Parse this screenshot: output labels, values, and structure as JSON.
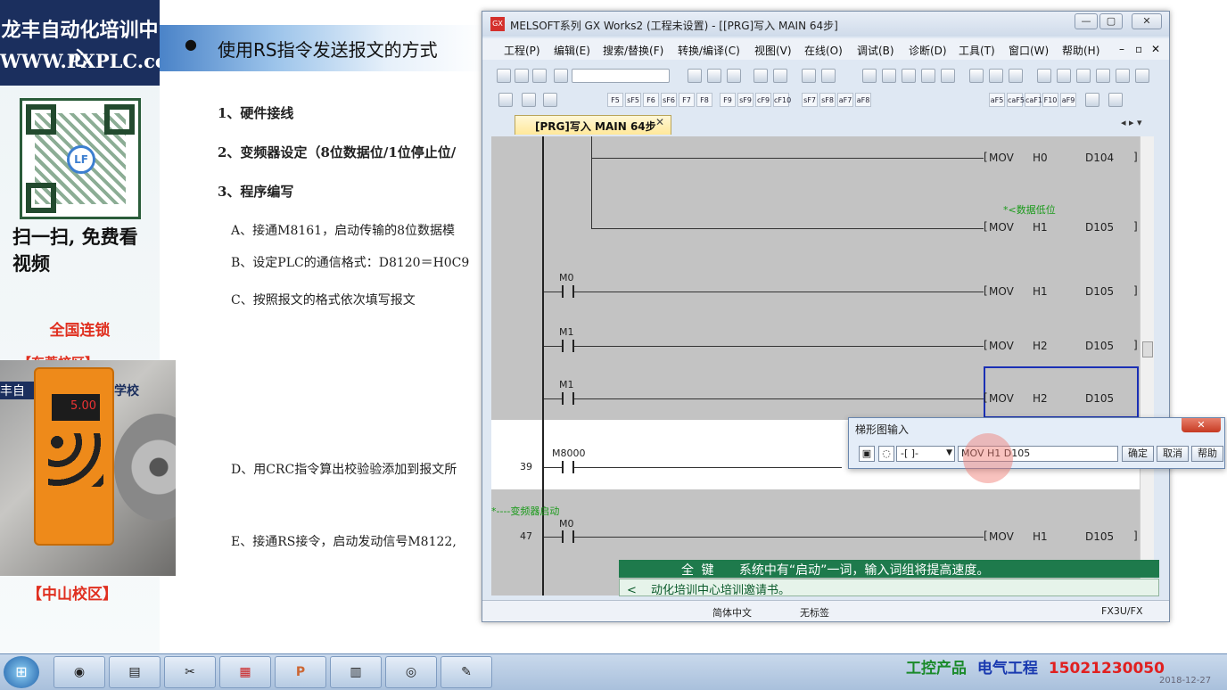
{
  "brand": {
    "line1": "龙丰自动化培训中心",
    "line2": "WWW.PXPLC.com",
    "qr_logo": "LF",
    "scan_text": "扫一扫, 免费看视频",
    "chain": "全国连锁",
    "campus1": "【东莞校区】",
    "campus2": "【中山校区】",
    "video_sign1": "丰自",
    "video_sign2": "学校",
    "vfd_display": "5.00"
  },
  "slide": {
    "title": "使用RS指令发送报文的方式",
    "items": [
      "1、硬件接线",
      "2、变频器设定（8位数据位/1位停止位/",
      "3、程序编写",
      "A、接通M8161，启动传输的8位数据模",
      "B、设定PLC的通信格式：D8120＝H0C9",
      "C、按照报文的格式依次填写报文",
      "D、用CRC指令算出校验验添加到报文所",
      "E、接通RS接令，启动发动信号M8122,"
    ]
  },
  "gx": {
    "title": "MELSOFT系列 GX Works2 (工程未设置) - [[PRG]写入 MAIN 64步]",
    "app_icon": "GX",
    "menus": [
      "工程(P)",
      "编辑(E)",
      "搜索/替换(F)",
      "转换/编译(C)",
      "视图(V)",
      "在线(O)",
      "调试(B)",
      "诊断(D)",
      "工具(T)",
      "窗口(W)",
      "帮助(H)"
    ],
    "fkeys": [
      "F5",
      "sF5",
      "F6",
      "sF6",
      "F7",
      "F8",
      "F9",
      "sF9",
      "cF9",
      "cF10",
      "sF7",
      "sF8",
      "aF7",
      "aF8",
      "aF5",
      "caF5",
      "caF10",
      "F10",
      "aF9"
    ],
    "tab_label": "[PRG]写入 MAIN 64步",
    "ladder": {
      "rows": [
        {
          "instr": "MOV",
          "src": "H0",
          "dst": "D104"
        },
        {
          "comment": "*<数据低位"
        },
        {
          "instr": "MOV",
          "src": "H1",
          "dst": "D105"
        },
        {
          "contact": "M0",
          "instr": "MOV",
          "src": "H1",
          "dst": "D105"
        },
        {
          "contact": "M1",
          "instr": "MOV",
          "src": "H2",
          "dst": "D105"
        },
        {
          "contact": "M1",
          "instr": "MOV",
          "src": "H2",
          "dst": "D105"
        },
        {
          "step": "39",
          "contact": "M8000"
        },
        {
          "comment": "*----变频器启动"
        },
        {
          "step": "47",
          "contact": "M0",
          "instr": "MOV",
          "src": "H1",
          "dst": "D105"
        }
      ]
    },
    "status": {
      "lang": "简体中文",
      "label": "无标签",
      "cpu": "FX3U/FX"
    }
  },
  "ime": {
    "mode1": "全",
    "mode2": "键",
    "hint": "系统中有“启动”一词，输入词组将提高速度。",
    "candidate": "动化培训中心培训邀请书。"
  },
  "dialog": {
    "title": "梯形图输入",
    "select": "-[ ]-",
    "input": "MOV H1 D105",
    "ok": "确定",
    "cancel": "取消",
    "help": "帮助"
  },
  "taskbar": {
    "ad_a": "工控产品",
    "ad_b": "电气工程",
    "phone": "15021230050",
    "date": "2018-12-27"
  }
}
